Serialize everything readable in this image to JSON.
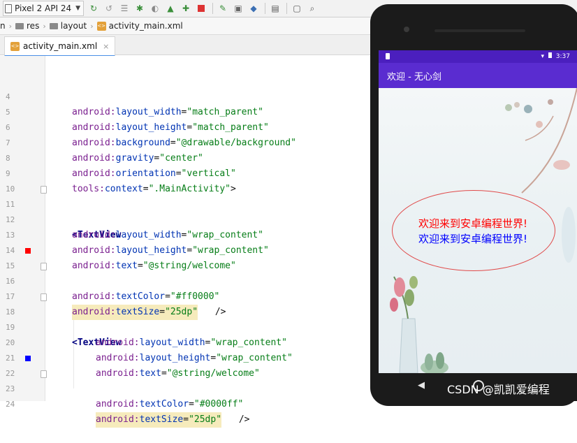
{
  "toolbar": {
    "device": "Pixel 2 API 24",
    "icons": [
      "sync-icon",
      "undo-icon",
      "layout-icon",
      "debug-icon",
      "profile-icon",
      "android-icon",
      "stop-icon",
      "device-manager-icon",
      "sdk-icon",
      "gradle-icon",
      "project-icon",
      "search-icon"
    ]
  },
  "breadcrumb": {
    "items": [
      "n",
      "res",
      "layout",
      "activity_main.xml"
    ]
  },
  "tab": {
    "label": "activity_main.xml",
    "close": "×"
  },
  "editor": {
    "lines": [
      {
        "n": "4",
        "text": "android:layout_width=\"match_parent\""
      },
      {
        "n": "5",
        "text": "android:layout_height=\"match_parent\""
      },
      {
        "n": "6",
        "text": "android:background=\"@drawable/background\""
      },
      {
        "n": "7",
        "text": "android:gravity=\"center\""
      },
      {
        "n": "8",
        "text": "android:orientation=\"vertical\""
      },
      {
        "n": "9",
        "text": "tools:context=\".MainActivity\">"
      },
      {
        "n": "10",
        "text": ""
      },
      {
        "n": "11",
        "text": "<TextView"
      },
      {
        "n": "12",
        "text": "android:layout_width=\"wrap_content\""
      },
      {
        "n": "13",
        "text": "android:layout_height=\"wrap_content\""
      },
      {
        "n": "14",
        "text": "android:text=\"@string/welcome\""
      },
      {
        "n": "15",
        "text": "android:textColor=\"#ff0000\""
      },
      {
        "n": "16",
        "text": "android:textSize=\"25dp\" />"
      },
      {
        "n": "17",
        "text": ""
      },
      {
        "n": "18",
        "text": "<TextView"
      },
      {
        "n": "19",
        "text": "android:layout_width=\"wrap_content\""
      },
      {
        "n": "20",
        "text": "android:layout_height=\"wrap_content\""
      },
      {
        "n": "21",
        "text": "android:text=\"@string/welcome\""
      },
      {
        "n": "22",
        "text": "android:textColor=\"#0000ff\""
      },
      {
        "n": "23",
        "text": "android:textSize=\"25dp\" />"
      },
      {
        "n": "24",
        "text": ""
      }
    ],
    "marker_colors": {
      "red": "#ff0000",
      "blue": "#0000ff"
    }
  },
  "phone": {
    "status_time": "3:37",
    "app_title": "欢迎 - 无心剑",
    "message_red": "欢迎来到安卓编程世界!",
    "message_blue": "欢迎来到安卓编程世界!",
    "watermark": "CSDN @凯凯爱编程"
  }
}
